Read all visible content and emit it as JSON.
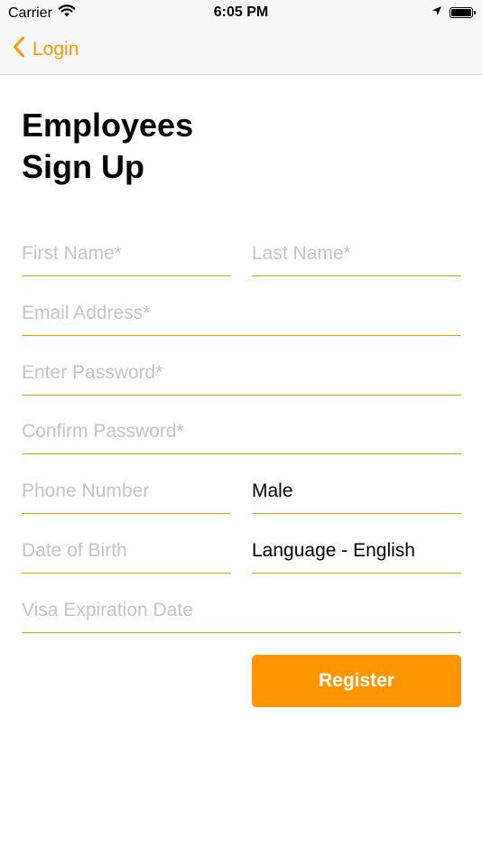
{
  "status_bar": {
    "carrier": "Carrier",
    "time": "6:05 PM"
  },
  "nav": {
    "back_label": "Login"
  },
  "title": {
    "line1": "Employees",
    "line2": "Sign Up"
  },
  "form": {
    "first_name": {
      "placeholder": "First Name*",
      "value": ""
    },
    "last_name": {
      "placeholder": "Last Name*",
      "value": ""
    },
    "email": {
      "placeholder": "Email Address*",
      "value": ""
    },
    "password": {
      "placeholder": "Enter Password*",
      "value": ""
    },
    "confirm_password": {
      "placeholder": "Confirm Password*",
      "value": ""
    },
    "phone": {
      "placeholder": "Phone Number",
      "value": ""
    },
    "gender": {
      "value": "Male"
    },
    "date_of_birth": {
      "placeholder": "Date of Birth",
      "value": ""
    },
    "language": {
      "value": "Language - English"
    },
    "visa_expiration": {
      "placeholder": "Visa Expiration Date",
      "value": ""
    },
    "register_label": "Register"
  },
  "colors": {
    "accent": "#ff9500",
    "placeholder": "#c4c4c6",
    "nav_background": "#f7f7f7"
  },
  "icons": {
    "wifi": "wifi-icon",
    "back": "chevron-left-icon",
    "location": "location-arrow-icon",
    "battery": "battery-icon"
  }
}
